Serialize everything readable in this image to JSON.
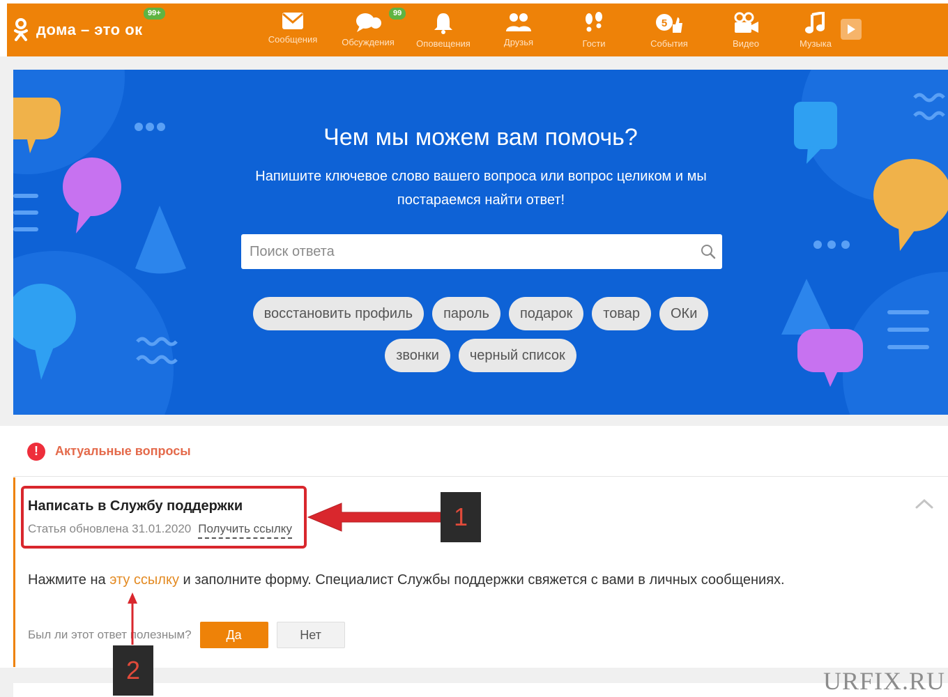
{
  "topbar": {
    "brand": "дома – это ок",
    "badges": {
      "brand": "99+",
      "discussions": "99"
    },
    "nav": [
      {
        "label": "Сообщения",
        "icon": "envelope-icon"
      },
      {
        "label": "Обсуждения",
        "icon": "chat-bubbles-icon"
      },
      {
        "label": "Оповещения",
        "icon": "bell-icon"
      },
      {
        "label": "Друзья",
        "icon": "friends-icon"
      },
      {
        "label": "Гости",
        "icon": "footprints-icon"
      },
      {
        "label": "События",
        "icon": "events-like-icon"
      },
      {
        "label": "Видео",
        "icon": "video-camera-icon"
      },
      {
        "label": "Музыка",
        "icon": "music-note-icon"
      }
    ]
  },
  "hero": {
    "title": "Чем мы можем вам помочь?",
    "subtitle": "Напишите ключевое слово вашего вопроса или вопрос целиком и мы постараемся найти ответ!",
    "search_placeholder": "Поиск ответа",
    "tags_row1": [
      "восстановить профиль",
      "пароль",
      "подарок",
      "товар",
      "ОКи"
    ],
    "tags_row2": [
      "звонки",
      "черный список"
    ]
  },
  "section": {
    "title": "Актуальные вопросы"
  },
  "question": {
    "title": "Написать в Службу поддержки",
    "updated": "Статья обновлена 31.01.2020",
    "get_link": "Получить ссылку",
    "answer_before": "Нажмите на ",
    "answer_link": "эту ссылку",
    "answer_after": " и заполните форму. Специалист Службы поддержки свяжется с вами в личных сообщениях.",
    "helpful_label": "Был ли этот ответ полезным?",
    "yes": "Да",
    "no": "Нет"
  },
  "annotations": {
    "marker1": "1",
    "marker2": "2"
  },
  "watermark": "URFIX.RU",
  "colors": {
    "brand_orange": "#ee8208",
    "hero_blue": "#0e62d6",
    "annotation_red": "#d9272d",
    "link_orange": "#e38a22"
  }
}
